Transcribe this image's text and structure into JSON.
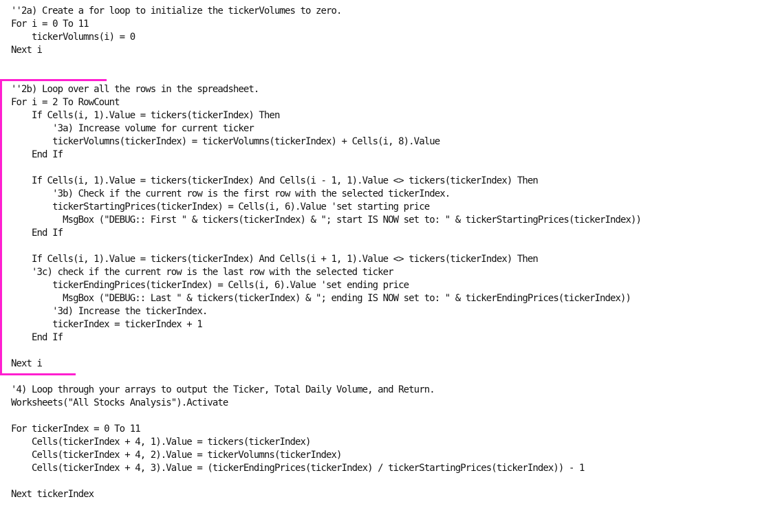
{
  "code_lines": [
    "''2a) Create a for loop to initialize the tickerVolumes to zero.",
    "For i = 0 To 11",
    "    tickerVolumns(i) = 0",
    "Next i",
    "",
    "",
    "''2b) Loop over all the rows in the spreadsheet.",
    "For i = 2 To RowCount",
    "    If Cells(i, 1).Value = tickers(tickerIndex) Then",
    "        '3a) Increase volume for current ticker",
    "        tickerVolumns(tickerIndex) = tickerVolumns(tickerIndex) + Cells(i, 8).Value",
    "    End If",
    "",
    "    If Cells(i, 1).Value = tickers(tickerIndex) And Cells(i - 1, 1).Value <> tickers(tickerIndex) Then",
    "        '3b) Check if the current row is the first row with the selected tickerIndex.",
    "        tickerStartingPrices(tickerIndex) = Cells(i, 6).Value 'set starting price",
    "          MsgBox (\"DEBUG:: First \" & tickers(tickerIndex) & \"; start IS NOW set to: \" & tickerStartingPrices(tickerIndex))",
    "    End If",
    "",
    "    If Cells(i, 1).Value = tickers(tickerIndex) And Cells(i + 1, 1).Value <> tickers(tickerIndex) Then",
    "    '3c) check if the current row is the last row with the selected ticker",
    "        tickerEndingPrices(tickerIndex) = Cells(i, 6).Value 'set ending price",
    "          MsgBox (\"DEBUG:: Last \" & tickers(tickerIndex) & \"; ending IS NOW set to: \" & tickerEndingPrices(tickerIndex))",
    "        '3d) Increase the tickerIndex.",
    "        tickerIndex = tickerIndex + 1",
    "    End If",
    "",
    "Next i",
    "",
    "'4) Loop through your arrays to output the Ticker, Total Daily Volume, and Return.",
    "Worksheets(\"All Stocks Analysis\").Activate",
    "",
    "For tickerIndex = 0 To 11",
    "    Cells(tickerIndex + 4, 1).Value = tickers(tickerIndex)",
    "    Cells(tickerIndex + 4, 2).Value = tickerVolumns(tickerIndex)",
    "    Cells(tickerIndex + 4, 3).Value = (tickerEndingPrices(tickerIndex) / tickerStartingPrices(tickerIndex)) - 1",
    "",
    "Next tickerIndex"
  ],
  "highlight_color": "#ff1fd0"
}
